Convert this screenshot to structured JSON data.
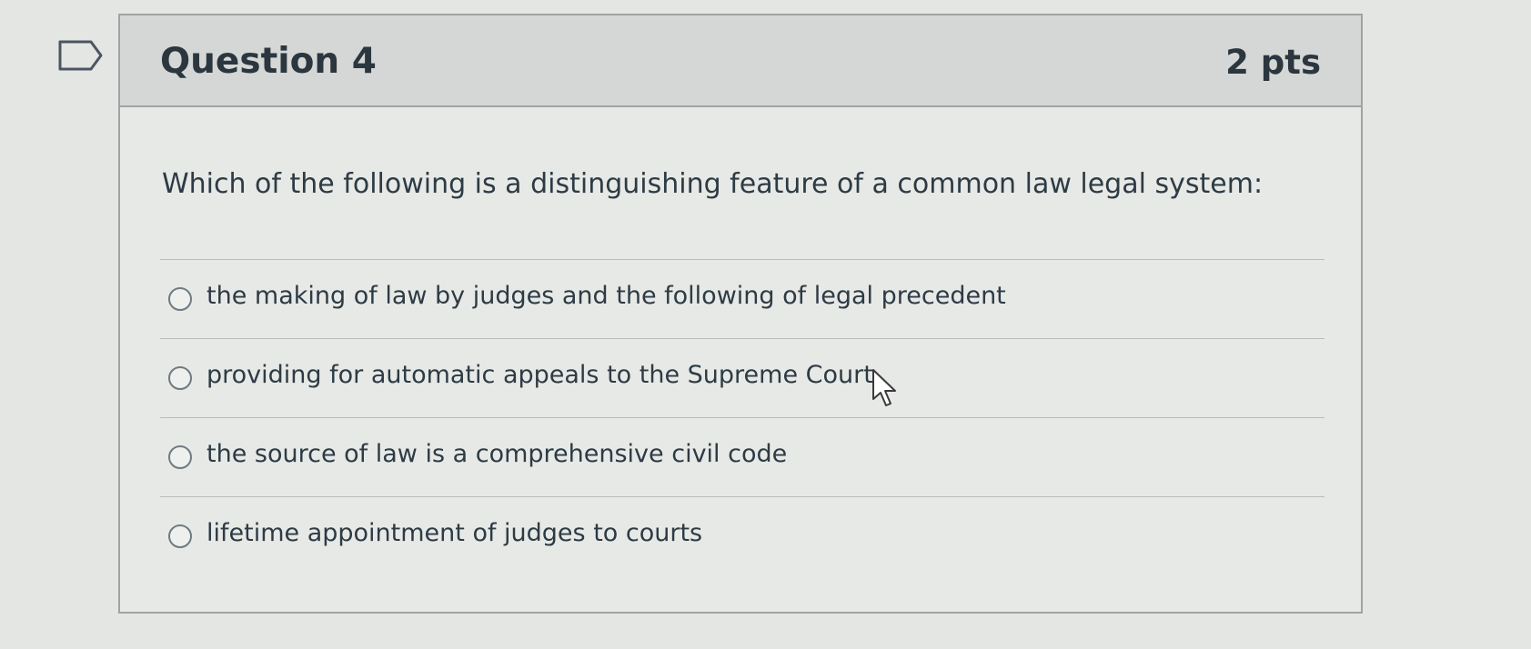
{
  "question": {
    "title": "Question 4",
    "points": "2 pts",
    "text": "Which of the following is a distinguishing feature of a common law legal system:",
    "flag_icon": "flag-icon",
    "answers": [
      {
        "label": "the making of law by judges and the following of legal precedent",
        "selected": false
      },
      {
        "label": "providing for automatic appeals to the Supreme Court",
        "selected": false
      },
      {
        "label": "the source of law is a comprehensive civil code",
        "selected": false
      },
      {
        "label": "lifetime appointment of judges to courts",
        "selected": false
      }
    ]
  },
  "colors": {
    "background": "#e4e6e3",
    "header_background": "#d4d7d5",
    "border": "#9fa3a4",
    "text": "#2d3b45"
  }
}
